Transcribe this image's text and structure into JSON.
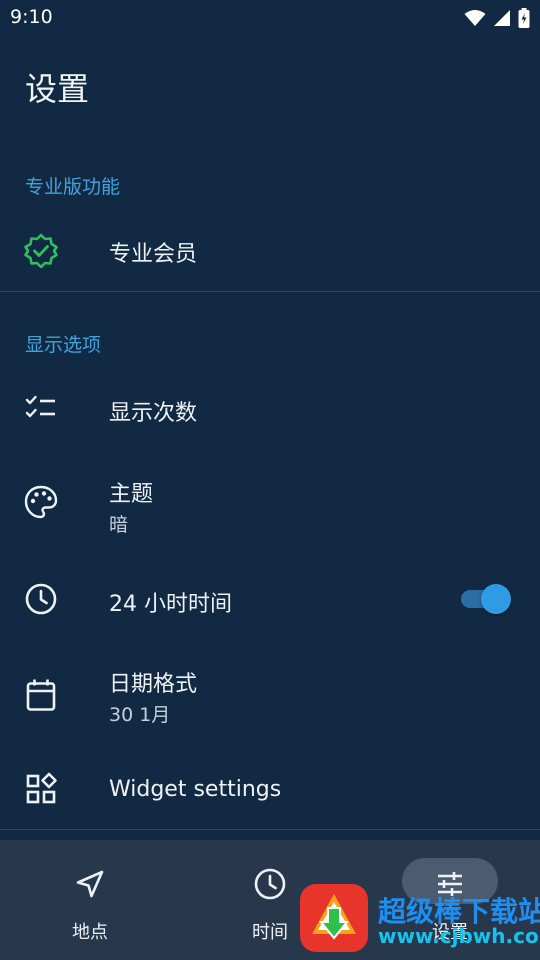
{
  "status_bar": {
    "time": "9:10",
    "icons": [
      "wifi-icon",
      "signal-icon",
      "battery-charging-icon"
    ]
  },
  "header": {
    "title": "设置"
  },
  "sections": {
    "pro": {
      "header": "专业版功能",
      "items": [
        {
          "title": "专业会员",
          "icon": "verified-badge-icon"
        }
      ]
    },
    "display": {
      "header": "显示选项",
      "items": [
        {
          "title": "显示次数",
          "icon": "checklist-icon"
        },
        {
          "title": "主题",
          "subtitle": "暗",
          "icon": "palette-icon"
        },
        {
          "title": "24 小时时间",
          "icon": "clock-icon",
          "toggle_on": true
        },
        {
          "title": "日期格式",
          "subtitle": "30 1月",
          "icon": "calendar-icon"
        },
        {
          "title": "Widget settings",
          "icon": "widgets-icon"
        }
      ]
    }
  },
  "bottom_nav": {
    "items": [
      {
        "label": "地点",
        "icon": "navigation-arrow-icon"
      },
      {
        "label": "时间",
        "icon": "clock-icon"
      },
      {
        "label": "设置",
        "icon": "tune-icon",
        "active": true
      }
    ]
  },
  "watermark": {
    "title": "超级棒下载站",
    "url": "www.cjbwh.com"
  },
  "colors": {
    "background": "#112943",
    "accent": "#3fa4dd",
    "badge_green": "#2fbf5b",
    "nav_background": "#27384d",
    "toggle_thumb": "#2f9be4"
  }
}
